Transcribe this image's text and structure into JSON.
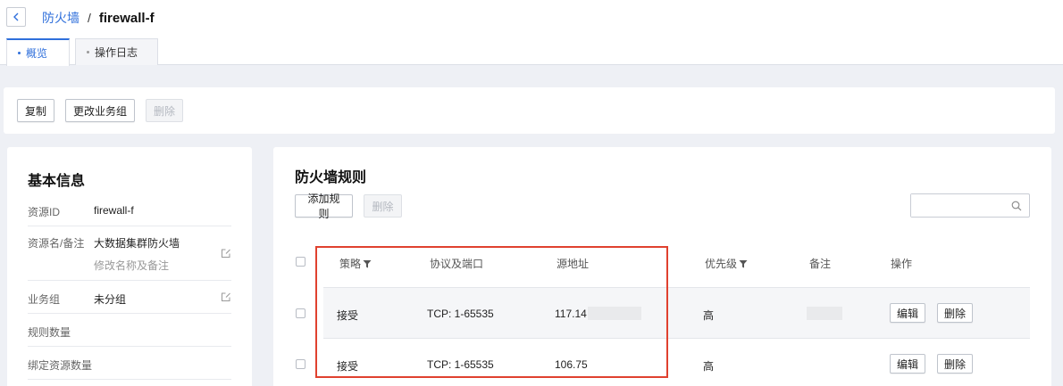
{
  "breadcrumb": {
    "parent": "防火墙",
    "separator": "/",
    "current": "firewall-f"
  },
  "tabs": [
    {
      "label": "概览",
      "active": true
    },
    {
      "label": "操作日志",
      "active": false
    }
  ],
  "actions": {
    "copy": "复制",
    "change_group": "更改业务组",
    "delete": "删除"
  },
  "basic_info": {
    "title": "基本信息",
    "rows": [
      {
        "label": "资源ID",
        "value": "firewall-f"
      },
      {
        "label": "资源名/备注",
        "value": "大数据集群防火墙",
        "sub": "修改名称及备注"
      },
      {
        "label": "业务组",
        "value": "未分组"
      },
      {
        "label": "规则数量",
        "value": ""
      },
      {
        "label": "绑定资源数量",
        "value": ""
      }
    ]
  },
  "rules": {
    "title": "防火墙规则",
    "add_label": "添加规则",
    "delete_label": "删除",
    "search_placeholder": "",
    "columns": {
      "policy": "策略",
      "protocol": "协议及端口",
      "source": "源地址",
      "priority": "优先级",
      "note": "备注",
      "ops": "操作"
    },
    "rows": [
      {
        "policy": "接受",
        "protocol": "TCP: 1-65535",
        "source": "117.14",
        "priority": "高",
        "edit": "编辑",
        "delete": "删除"
      },
      {
        "policy": "接受",
        "protocol": "TCP: 1-65535",
        "source": "106.75",
        "priority": "高",
        "edit": "编辑",
        "delete": "删除"
      }
    ]
  },
  "colors": {
    "accent": "#2f6fdb",
    "highlight": "#e0412f"
  }
}
